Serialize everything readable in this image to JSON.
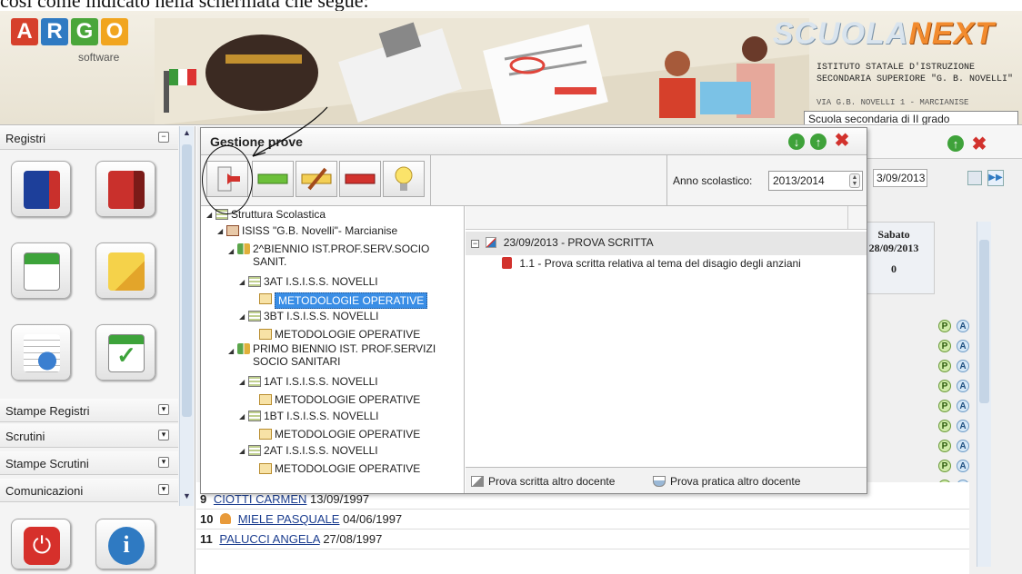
{
  "doc": {
    "line": "così come indicato nella schermata che segue:"
  },
  "header": {
    "logo_letters": [
      "A",
      "R",
      "G",
      "O"
    ],
    "logo_colors": [
      "#d6402b",
      "#2f7ac2",
      "#4aa63a",
      "#f1a51f"
    ],
    "logo_sub": "software",
    "brand_a": "SCUOLA",
    "brand_b": "NEXT",
    "school_name": "ISTITUTO STATALE D'ISTRUZIONE SECONDARIA SUPERIORE \"G. B. NOVELLI\"",
    "school_addr": "VIA G.B. NOVELLI 1 - MARCIANISE",
    "school_type": "Scuola secondaria di II grado"
  },
  "sidebar": {
    "sections": [
      "Registri",
      "Stampe Registri",
      "Scrutini",
      "Stampe Scrutini",
      "Comunicazioni"
    ],
    "toggle_collapse": "−",
    "toggle_expand": "▾"
  },
  "dialog": {
    "title": "Gestione prove",
    "anno_label": "Anno scolastico:",
    "anno_value": "2013/2014",
    "tree": {
      "root": "Struttura Scolastica",
      "school": "ISISS \"G.B. Novelli\"- Marcianise",
      "group1": "2^BIENNIO IST.PROF.SERV.SOCIO SANIT.",
      "group1_classes": [
        "3AT I.S.I.S.S. NOVELLI",
        "3BT I.S.I.S.S. NOVELLI"
      ],
      "group2": "PRIMO BIENNIO IST. PROF.SERVIZI SOCIO SANITARI",
      "group2_classes": [
        "1AT I.S.I.S.S. NOVELLI",
        "1BT I.S.I.S.S. NOVELLI",
        "2AT I.S.I.S.S. NOVELLI"
      ],
      "subject": "METODOLOGIE OPERATIVE"
    },
    "prova_header": "23/09/2013 - PROVA SCRITTA",
    "prova_item": "1.1 - Prova scritta relativa al tema del disagio degli anziani",
    "footer_scritta": "Prova scritta altro docente",
    "footer_pratica": "Prova pratica altro docente"
  },
  "background": {
    "date_value": "3/09/2013",
    "day_name": "Sabato",
    "day_date": "28/09/2013",
    "day_count": "0",
    "rows": [
      {
        "num": "9",
        "name": "CIOTTI CARMEN",
        "date": "13/09/1997"
      },
      {
        "num": "10",
        "name": "MIELE PASQUALE",
        "date": "04/06/1997"
      },
      {
        "num": "11",
        "name": "PALUCCI ANGELA",
        "date": "27/08/1997"
      }
    ],
    "presence_p": "P",
    "presence_a": "A"
  },
  "colors": {
    "selection": "#3a8ee6",
    "green_btn": "#3fa23a",
    "red_btn": "#d2322d",
    "link": "#1b3d8f"
  }
}
